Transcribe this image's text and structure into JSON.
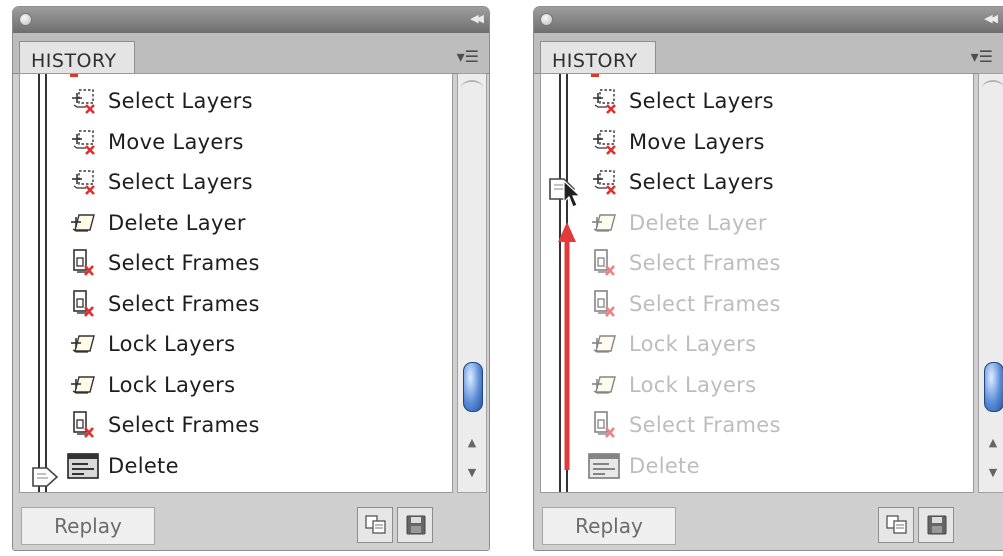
{
  "left": {
    "tab_label": "HISTORY",
    "replay_label": "Replay",
    "items": [
      {
        "label": "Select Layers",
        "icon": "select-layers-icon",
        "state": "active"
      },
      {
        "label": "Move Layers",
        "icon": "select-layers-icon",
        "state": "active"
      },
      {
        "label": "Select Layers",
        "icon": "select-layers-icon",
        "state": "active"
      },
      {
        "label": "Delete Layer",
        "icon": "layer-action-icon",
        "state": "active"
      },
      {
        "label": "Select Frames",
        "icon": "select-frames-icon",
        "state": "active"
      },
      {
        "label": "Select Frames",
        "icon": "select-frames-icon",
        "state": "active"
      },
      {
        "label": "Lock Layers",
        "icon": "layer-action-icon",
        "state": "active"
      },
      {
        "label": "Lock Layers",
        "icon": "layer-action-icon",
        "state": "active"
      },
      {
        "label": "Select Frames",
        "icon": "select-frames-icon",
        "state": "active"
      },
      {
        "label": "Delete",
        "icon": "delete-icon",
        "state": "active"
      }
    ]
  },
  "right": {
    "tab_label": "HISTORY",
    "replay_label": "Replay",
    "items": [
      {
        "label": "Select Layers",
        "icon": "select-layers-icon",
        "state": "active"
      },
      {
        "label": "Move Layers",
        "icon": "select-layers-icon",
        "state": "active"
      },
      {
        "label": "Select Layers",
        "icon": "select-layers-icon",
        "state": "active"
      },
      {
        "label": "Delete Layer",
        "icon": "layer-action-icon",
        "state": "undone"
      },
      {
        "label": "Select Frames",
        "icon": "select-frames-icon",
        "state": "undone"
      },
      {
        "label": "Select Frames",
        "icon": "select-frames-icon",
        "state": "undone"
      },
      {
        "label": "Lock Layers",
        "icon": "layer-action-icon",
        "state": "undone"
      },
      {
        "label": "Lock Layers",
        "icon": "layer-action-icon",
        "state": "undone"
      },
      {
        "label": "Select Frames",
        "icon": "select-frames-icon",
        "state": "undone"
      },
      {
        "label": "Delete",
        "icon": "delete-icon",
        "state": "undone"
      }
    ]
  },
  "colors": {
    "drag_arrow": "#e23b3b",
    "undone_text": "#bdbdbd",
    "scroll_thumb": "#5b8cd8"
  }
}
